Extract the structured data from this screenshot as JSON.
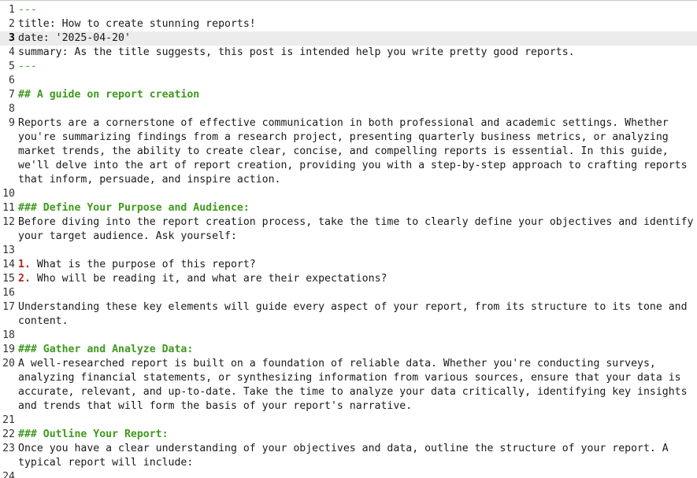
{
  "editor": {
    "lines": [
      {
        "num": "1",
        "text": "---",
        "kind": "delim"
      },
      {
        "num": "2",
        "text": "title: How to create stunning reports!",
        "kind": "plain"
      },
      {
        "num": "3",
        "text": "date: '2025-04-20'",
        "kind": "plain",
        "current": true
      },
      {
        "num": "4",
        "text": "summary: As the title suggests, this post is intended help you write pretty good reports.",
        "kind": "plain"
      },
      {
        "num": "5",
        "text": "---",
        "kind": "delim"
      },
      {
        "num": "6",
        "text": "",
        "kind": "plain"
      },
      {
        "num": "7",
        "text": "## A guide on report creation",
        "kind": "heading"
      },
      {
        "num": "8",
        "text": "",
        "kind": "plain"
      },
      {
        "num": "9",
        "text": "Reports are a cornerstone of effective communication in both professional and academic settings. Whether you're summarizing findings from a research project, presenting quarterly business metrics, or analyzing market trends, the ability to create clear, concise, and compelling reports is essential. In this guide, we'll delve into the art of report creation, providing you with a step-by-step approach to crafting reports that inform, persuade, and inspire action.",
        "kind": "plain"
      },
      {
        "num": "10",
        "text": "",
        "kind": "plain"
      },
      {
        "num": "11",
        "text": "### Define Your Purpose and Audience:",
        "kind": "heading"
      },
      {
        "num": "12",
        "text": "Before diving into the report creation process, take the time to clearly define your objectives and identify your target audience. Ask yourself:",
        "kind": "plain"
      },
      {
        "num": "13",
        "text": "",
        "kind": "plain"
      },
      {
        "num": "14",
        "marker": "1.",
        "text": " What is the purpose of this report?",
        "kind": "list"
      },
      {
        "num": "15",
        "marker": "2.",
        "text": " Who will be reading it, and what are their expectations?",
        "kind": "list"
      },
      {
        "num": "16",
        "text": "",
        "kind": "plain"
      },
      {
        "num": "17",
        "text": "Understanding these key elements will guide every aspect of your report, from its structure to its tone and content.",
        "kind": "plain"
      },
      {
        "num": "18",
        "text": "",
        "kind": "plain"
      },
      {
        "num": "19",
        "text": "### Gather and Analyze Data:",
        "kind": "heading"
      },
      {
        "num": "20",
        "text": "A well-researched report is built on a foundation of reliable data. Whether you're conducting surveys, analyzing financial statements, or synthesizing information from various sources, ensure that your data is accurate, relevant, and up-to-date. Take the time to analyze your data critically, identifying key insights and trends that will form the basis of your report's narrative.",
        "kind": "plain"
      },
      {
        "num": "21",
        "text": "",
        "kind": "plain"
      },
      {
        "num": "22",
        "text": "### Outline Your Report:",
        "kind": "heading"
      },
      {
        "num": "23",
        "text": "Once you have a clear understanding of your objectives and data, outline the structure of your report. A typical report will include:",
        "kind": "plain"
      },
      {
        "num": "24",
        "text": "",
        "kind": "plain"
      }
    ]
  },
  "colors": {
    "heading": "#3f9a1d",
    "list_marker": "#b0251c",
    "current_line": "#ececec"
  }
}
